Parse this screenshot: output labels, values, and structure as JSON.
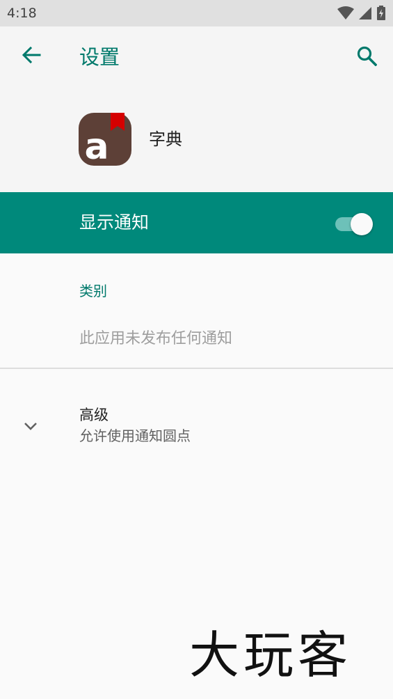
{
  "status_bar": {
    "time": "4:18",
    "icons": [
      "wifi-icon",
      "signal-icon",
      "battery-icon"
    ]
  },
  "app_bar": {
    "back_icon": "arrow-back-icon",
    "title": "设置",
    "search_icon": "search-icon"
  },
  "app": {
    "icon": "dictionary-app-icon",
    "icon_letter": "a",
    "name": "字典"
  },
  "master_toggle": {
    "label": "显示通知",
    "checked": true
  },
  "categories": {
    "header": "类别",
    "empty_text": "此应用未发布任何通知"
  },
  "advanced": {
    "icon": "chevron-down-icon",
    "title": "高级",
    "summary": "允许使用通知圆点"
  },
  "watermark": "大玩客",
  "colors": {
    "accent": "#00796b",
    "toggle_bar": "#00897b",
    "status_bar": "#e0e0e0",
    "app_icon_bg": "#5d4037",
    "bookmark": "#d50000"
  }
}
